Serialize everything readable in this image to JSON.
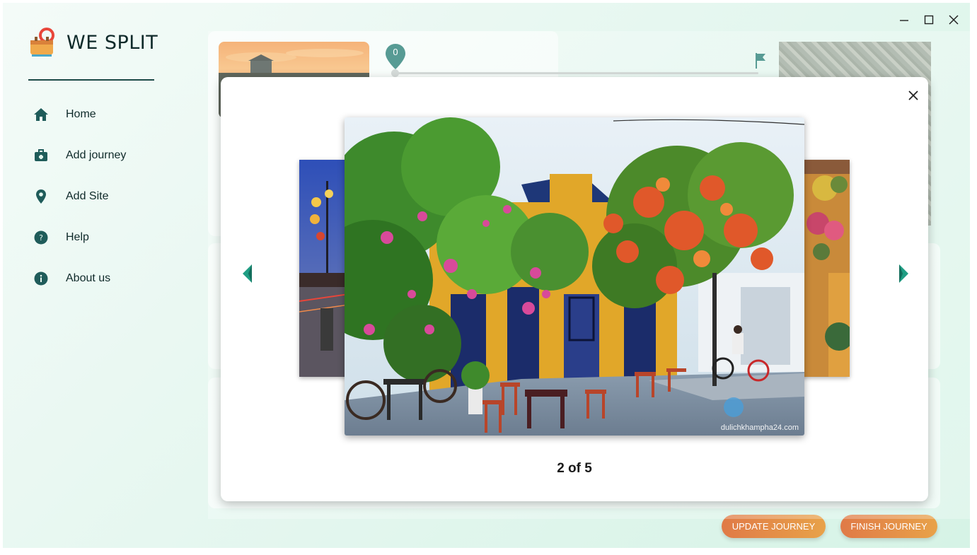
{
  "app": {
    "title": "WE SPLIT"
  },
  "sidebar": {
    "items": [
      {
        "label": "Home",
        "icon": "home-icon"
      },
      {
        "label": "Add journey",
        "icon": "briefcase-icon"
      },
      {
        "label": "Add Site",
        "icon": "location-pin-icon"
      },
      {
        "label": "Help",
        "icon": "help-icon"
      },
      {
        "label": "About us",
        "icon": "info-icon"
      }
    ]
  },
  "journey": {
    "progress_value": "0"
  },
  "actions": {
    "update_label": "UPDATE JOURNEY",
    "finish_label": "FINISH JOURNEY"
  },
  "gallery": {
    "counter": "2 of 5",
    "current_index": 2,
    "total": 5,
    "watermark": "dulichkhampha24.com"
  },
  "colors": {
    "accent": "#1f7a70",
    "button_gradient_start": "#e07a47",
    "button_gradient_end": "#e8a249"
  }
}
